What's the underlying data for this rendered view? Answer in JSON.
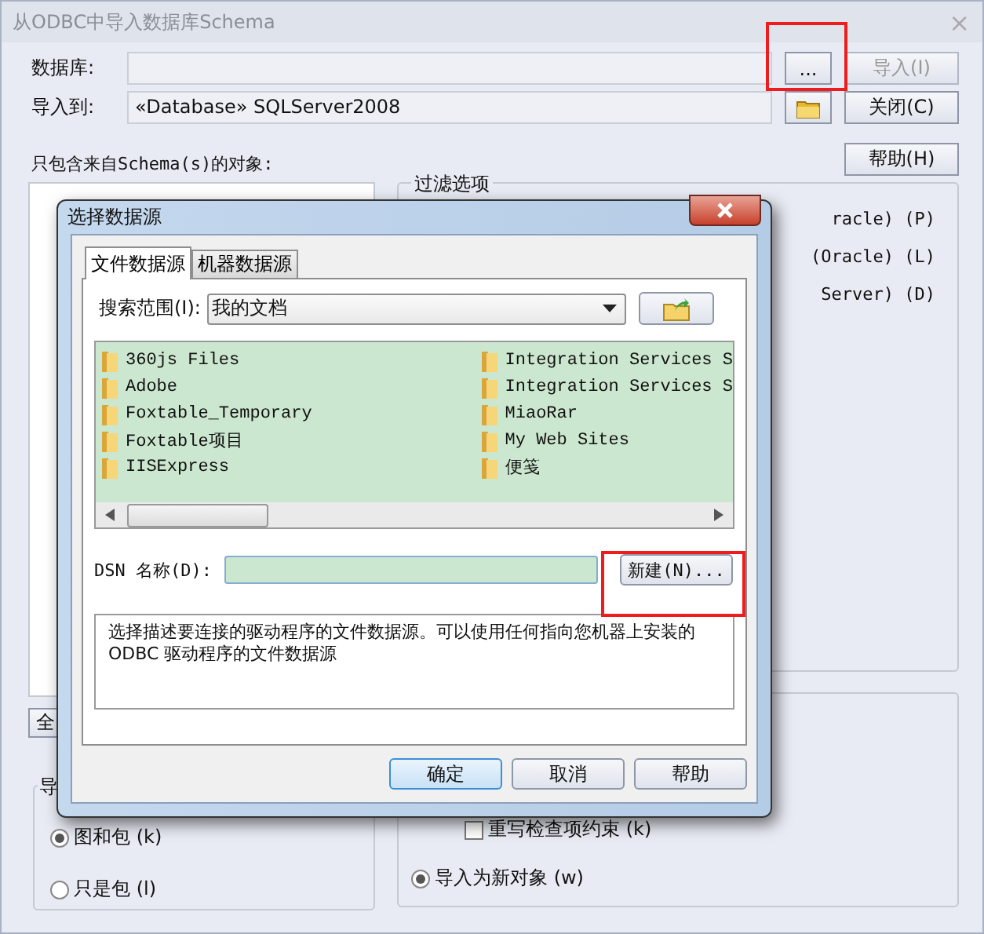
{
  "window": {
    "title": "从ODBC中导入数据库Schema",
    "close": "×"
  },
  "database": {
    "label": "数据库:",
    "browse_button": "...",
    "import_button": {
      "label": "导入(I)",
      "disabled": true
    }
  },
  "import_to": {
    "label": "导入到:",
    "value": "«Database» SQLServer2008",
    "close_button": "关闭(C)"
  },
  "help_button": "帮助(H)",
  "schema_label": "只包含来自Schema(s)的对象:",
  "filter_group": {
    "title": "过滤选项",
    "options": [
      {
        "label": "racle) (P)"
      },
      {
        "label": "(Oracle) (L)"
      },
      {
        "label": "Server) (D)"
      }
    ]
  },
  "select_all_button": "全",
  "import_group": {
    "title": "导",
    "options": [
      {
        "label": "图和包 (k)",
        "selected": true
      },
      {
        "label": "只是包 (l)",
        "selected": false
      }
    ]
  },
  "options_group": {
    "checkboxes": [
      {
        "label": "重写检查项约束 (k)",
        "checked": false
      }
    ],
    "radios": [
      {
        "label": "导入为新对象 (w)",
        "selected": true
      }
    ]
  },
  "dialog": {
    "title": "选择数据源",
    "tabs": [
      {
        "label": "文件数据源",
        "selected": true
      },
      {
        "label": "机器数据源",
        "selected": false
      }
    ],
    "look_in_label": "搜索范围(I):",
    "look_in_value": "我的文档",
    "files": [
      {
        "name": "360js Files"
      },
      {
        "name": "Adobe"
      },
      {
        "name": "Foxtable_Temporary"
      },
      {
        "name": "Foxtable项目"
      },
      {
        "name": "IISExpress"
      },
      {
        "name": "Integration Services S"
      },
      {
        "name": "Integration Services S"
      },
      {
        "name": "MiaoRar"
      },
      {
        "name": "My Web Sites"
      },
      {
        "name": "便笺"
      }
    ],
    "dsn_label": "DSN 名称(D):",
    "new_button": "新建(N)...",
    "description": "选择描述要连接的驱动程序的文件数据源。可以使用任何指向您机器上安装的 ODBC 驱动程序的文件数据源",
    "buttons": [
      {
        "label": "确定",
        "default": true
      },
      {
        "label": "取消",
        "default": false
      },
      {
        "label": "帮助",
        "default": false
      }
    ]
  }
}
